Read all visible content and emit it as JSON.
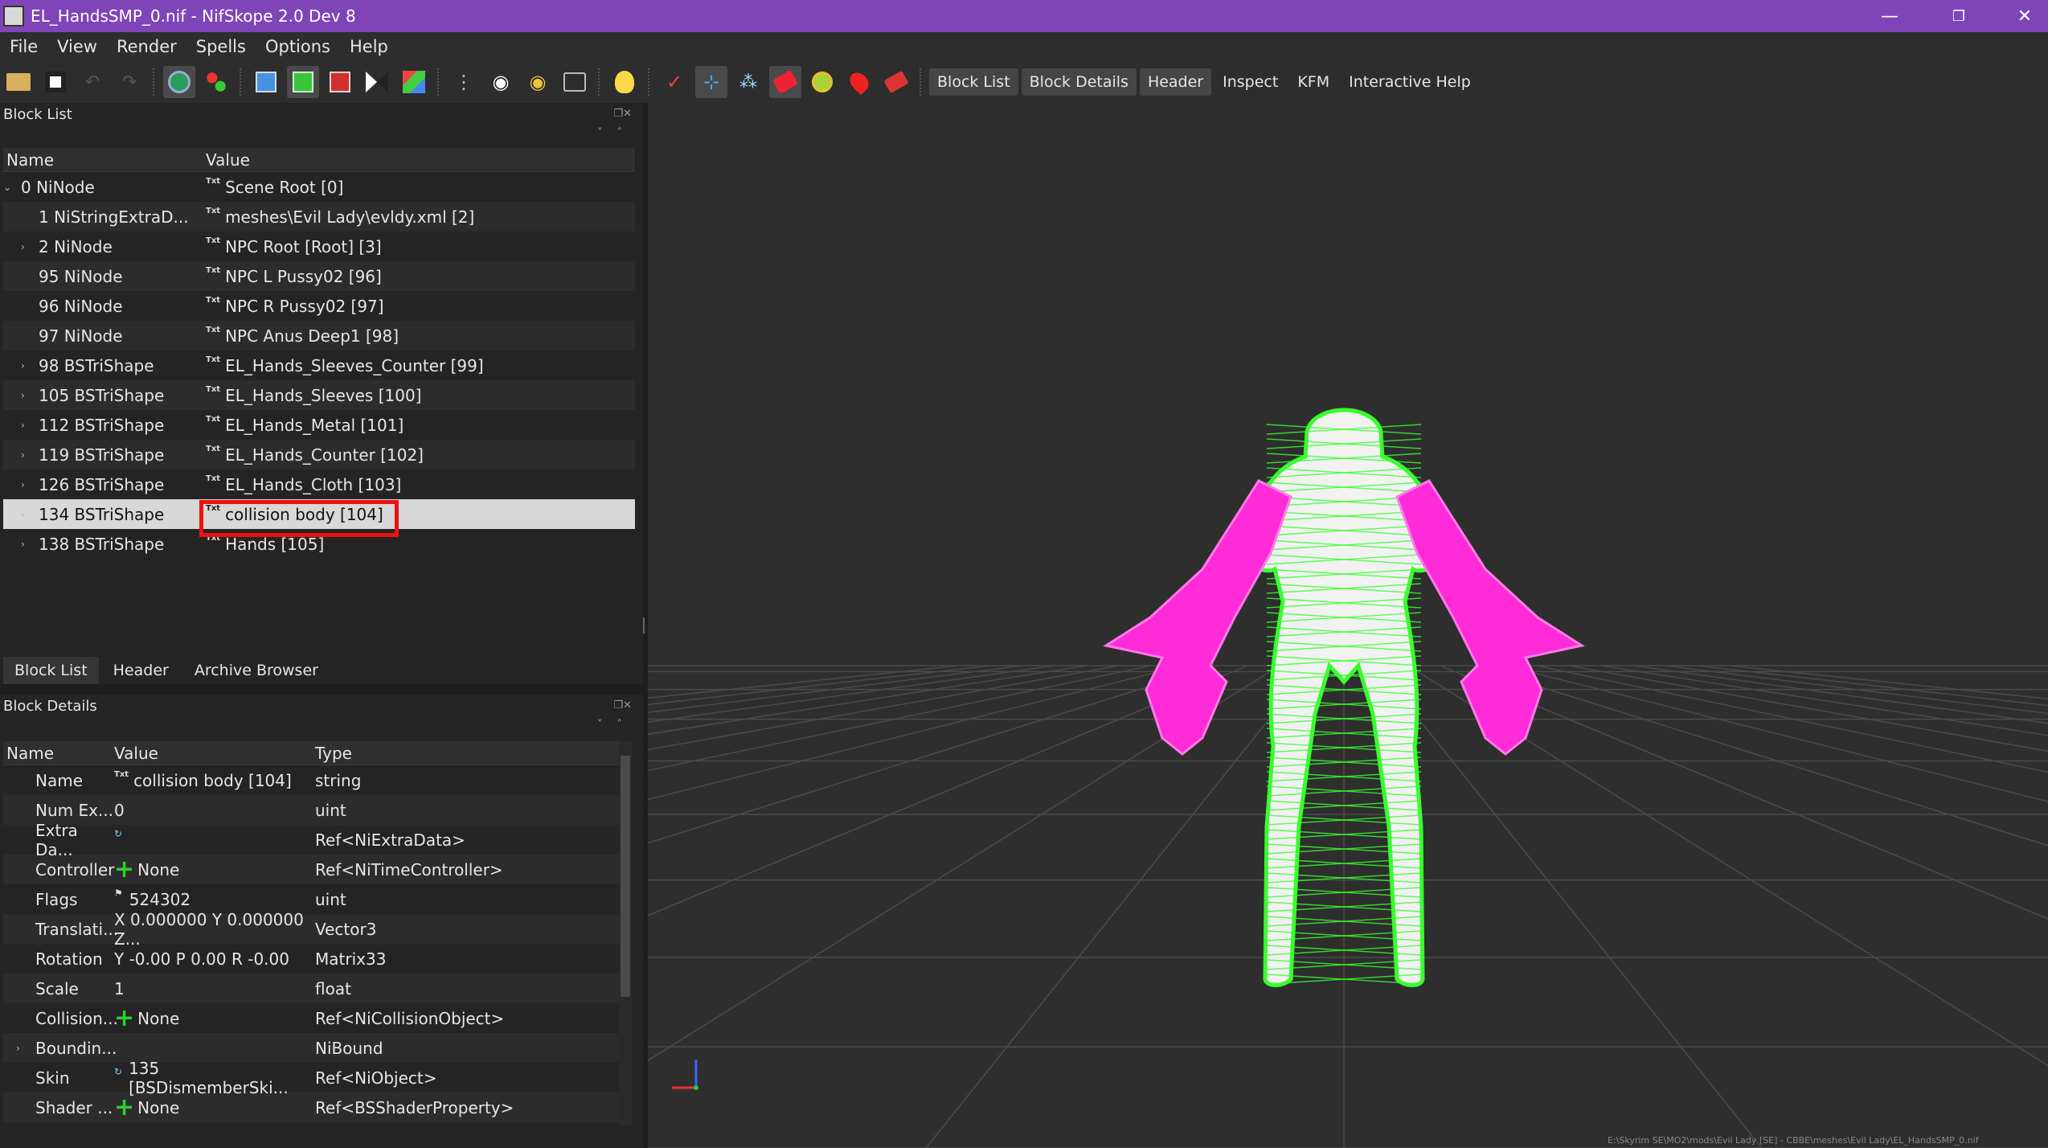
{
  "window": {
    "title": "EL_HandsSMP_0.nif - NifSkope 2.0 Dev 8",
    "controls": [
      "—",
      "❐",
      "✕"
    ]
  },
  "menu": [
    "File",
    "View",
    "Render",
    "Spells",
    "Options",
    "Help"
  ],
  "toolbar": {
    "text_buttons": [
      "Block List",
      "Block Details",
      "Header",
      "Inspect",
      "KFM",
      "Interactive Help"
    ]
  },
  "block_list": {
    "title": "Block List",
    "columns": [
      "Name",
      "Value"
    ],
    "rows": [
      {
        "name": "0 NiNode",
        "value": "Scene Root [0]",
        "expanded": true
      },
      {
        "name": "1 NiStringExtraD...",
        "value": "meshes\\Evil Lady\\evldy.xml [2]"
      },
      {
        "name": "2 NiNode",
        "value": "NPC Root [Root] [3]",
        "collapsed": true
      },
      {
        "name": "95 NiNode",
        "value": "NPC L Pussy02 [96]"
      },
      {
        "name": "96 NiNode",
        "value": "NPC R Pussy02 [97]"
      },
      {
        "name": "97 NiNode",
        "value": "NPC Anus Deep1 [98]"
      },
      {
        "name": "98 BSTriShape",
        "value": "EL_Hands_Sleeves_Counter [99]",
        "collapsed": true
      },
      {
        "name": "105 BSTriShape",
        "value": "EL_Hands_Sleeves [100]",
        "collapsed": true
      },
      {
        "name": "112 BSTriShape",
        "value": "EL_Hands_Metal [101]",
        "collapsed": true
      },
      {
        "name": "119 BSTriShape",
        "value": "EL_Hands_Counter [102]",
        "collapsed": true
      },
      {
        "name": "126 BSTriShape",
        "value": "EL_Hands_Cloth [103]",
        "collapsed": true
      },
      {
        "name": "134 BSTriShape",
        "value": "collision body [104]",
        "collapsed": true,
        "selected": true
      },
      {
        "name": "138 BSTriShape",
        "value": "Hands [105]",
        "collapsed": true
      }
    ]
  },
  "bottom_tabs": [
    "Block List",
    "Header",
    "Archive Browser"
  ],
  "block_details": {
    "title": "Block Details",
    "columns": [
      "Name",
      "Value",
      "Type"
    ],
    "rows": [
      {
        "name": "Name",
        "value": "collision body [104]",
        "type": "string",
        "icon": "txt"
      },
      {
        "name": "Num Ex...",
        "value": "0",
        "type": "uint"
      },
      {
        "name": "Extra Da...",
        "value": "",
        "type": "Ref<NiExtraData>",
        "icon": "link"
      },
      {
        "name": "Controller",
        "value": "None",
        "type": "Ref<NiTimeController>",
        "icon": "plus"
      },
      {
        "name": "Flags",
        "value": "524302",
        "type": "uint",
        "icon": "flag"
      },
      {
        "name": "Translati...",
        "value": "X 0.000000 Y 0.000000 Z...",
        "type": "Vector3"
      },
      {
        "name": "Rotation",
        "value": "Y -0.00 P 0.00 R -0.00",
        "type": "Matrix33"
      },
      {
        "name": "Scale",
        "value": "1",
        "type": "float"
      },
      {
        "name": "Collision...",
        "value": "None",
        "type": "Ref<NiCollisionObject>",
        "icon": "plus"
      },
      {
        "name": "Boundin...",
        "value": "",
        "type": "NiBound",
        "collapsed": true
      },
      {
        "name": "Skin",
        "value": "135 [BSDismemberSki...",
        "type": "Ref<NiObject>",
        "icon": "link"
      },
      {
        "name": "Shader ...",
        "value": "None",
        "type": "Ref<BSShaderProperty>",
        "icon": "plus"
      }
    ]
  },
  "status": {
    "path": "E:\\Skyrim SE\\MO2\\mods\\Evil Lady [SE] - CBBE\\meshes\\Evil Lady\\EL_HandsSMP_0.nif"
  },
  "colors": {
    "titlebar": "#7f45b8",
    "body_mesh": "#39ff2e",
    "gloves": "#ff2bd8",
    "highlight": "#ee1111"
  }
}
